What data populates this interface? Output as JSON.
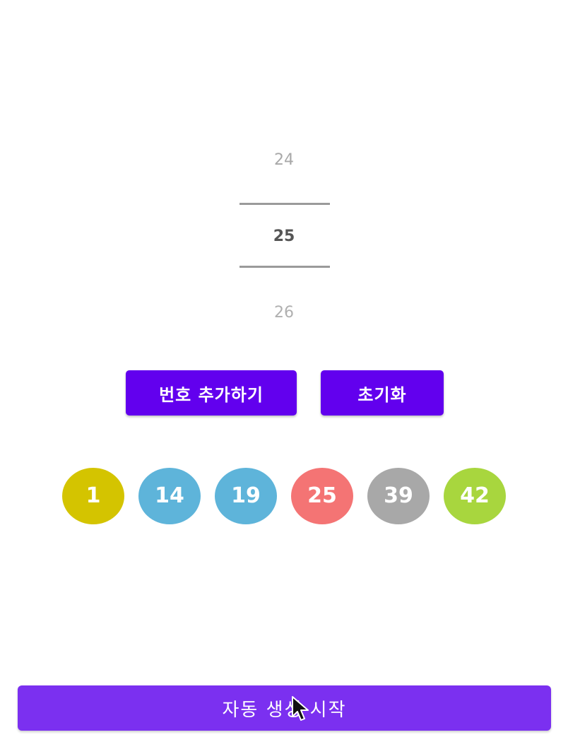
{
  "picker": {
    "prev": "24",
    "current": "25",
    "next": "26"
  },
  "buttons": {
    "add_label": "번호 추가하기",
    "reset_label": "초기화",
    "auto_label": "자동 생성 시작"
  },
  "balls": [
    {
      "number": "1",
      "color": "#d4c400"
    },
    {
      "number": "14",
      "color": "#5eb4da"
    },
    {
      "number": "19",
      "color": "#5eb4da"
    },
    {
      "number": "25",
      "color": "#f47474"
    },
    {
      "number": "39",
      "color": "#a8a8a8"
    },
    {
      "number": "42",
      "color": "#a8d63e"
    }
  ],
  "colors": {
    "primary_button": "#6200ee",
    "auto_button": "#7b30f0"
  },
  "icons": {
    "cursor": "mouse-pointer-icon"
  }
}
